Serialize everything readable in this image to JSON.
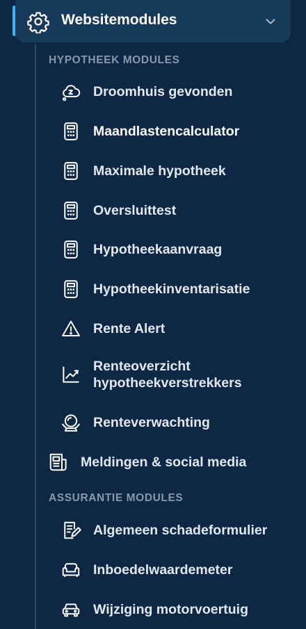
{
  "header": {
    "title": "Websitemodules",
    "icon": "gear-icon",
    "chevron": "chevron-down-icon"
  },
  "sections": {
    "hypotheek": "HYPOTHEEK MODULES",
    "assurantie": "ASSURANTIE MODULES"
  },
  "items": {
    "droomhuis": "Droomhuis gevonden",
    "maandlasten": "Maandlastencalculator",
    "maximale": "Maximale hypotheek",
    "oversluit": "Oversluittest",
    "aanvraag": "Hypotheekaanvraag",
    "inventarisatie": "Hypotheekinventarisatie",
    "rentealert": "Rente Alert",
    "renteoverzicht_1": "Renteoverzicht",
    "renteoverzicht_2": "hypotheekverstrekkers",
    "renteverwachting": "Renteverwachting",
    "meldingen": "Meldingen & social media",
    "schadeformulier": "Algemeen schadeformulier",
    "inboedel": "Inboedelwaardemeter",
    "motorvoertuig": "Wijziging motorvoertuig"
  },
  "colors": {
    "background": "#0d2744",
    "header": "#17395a",
    "accent": "#3ab4f2",
    "section": "#8799ad"
  }
}
